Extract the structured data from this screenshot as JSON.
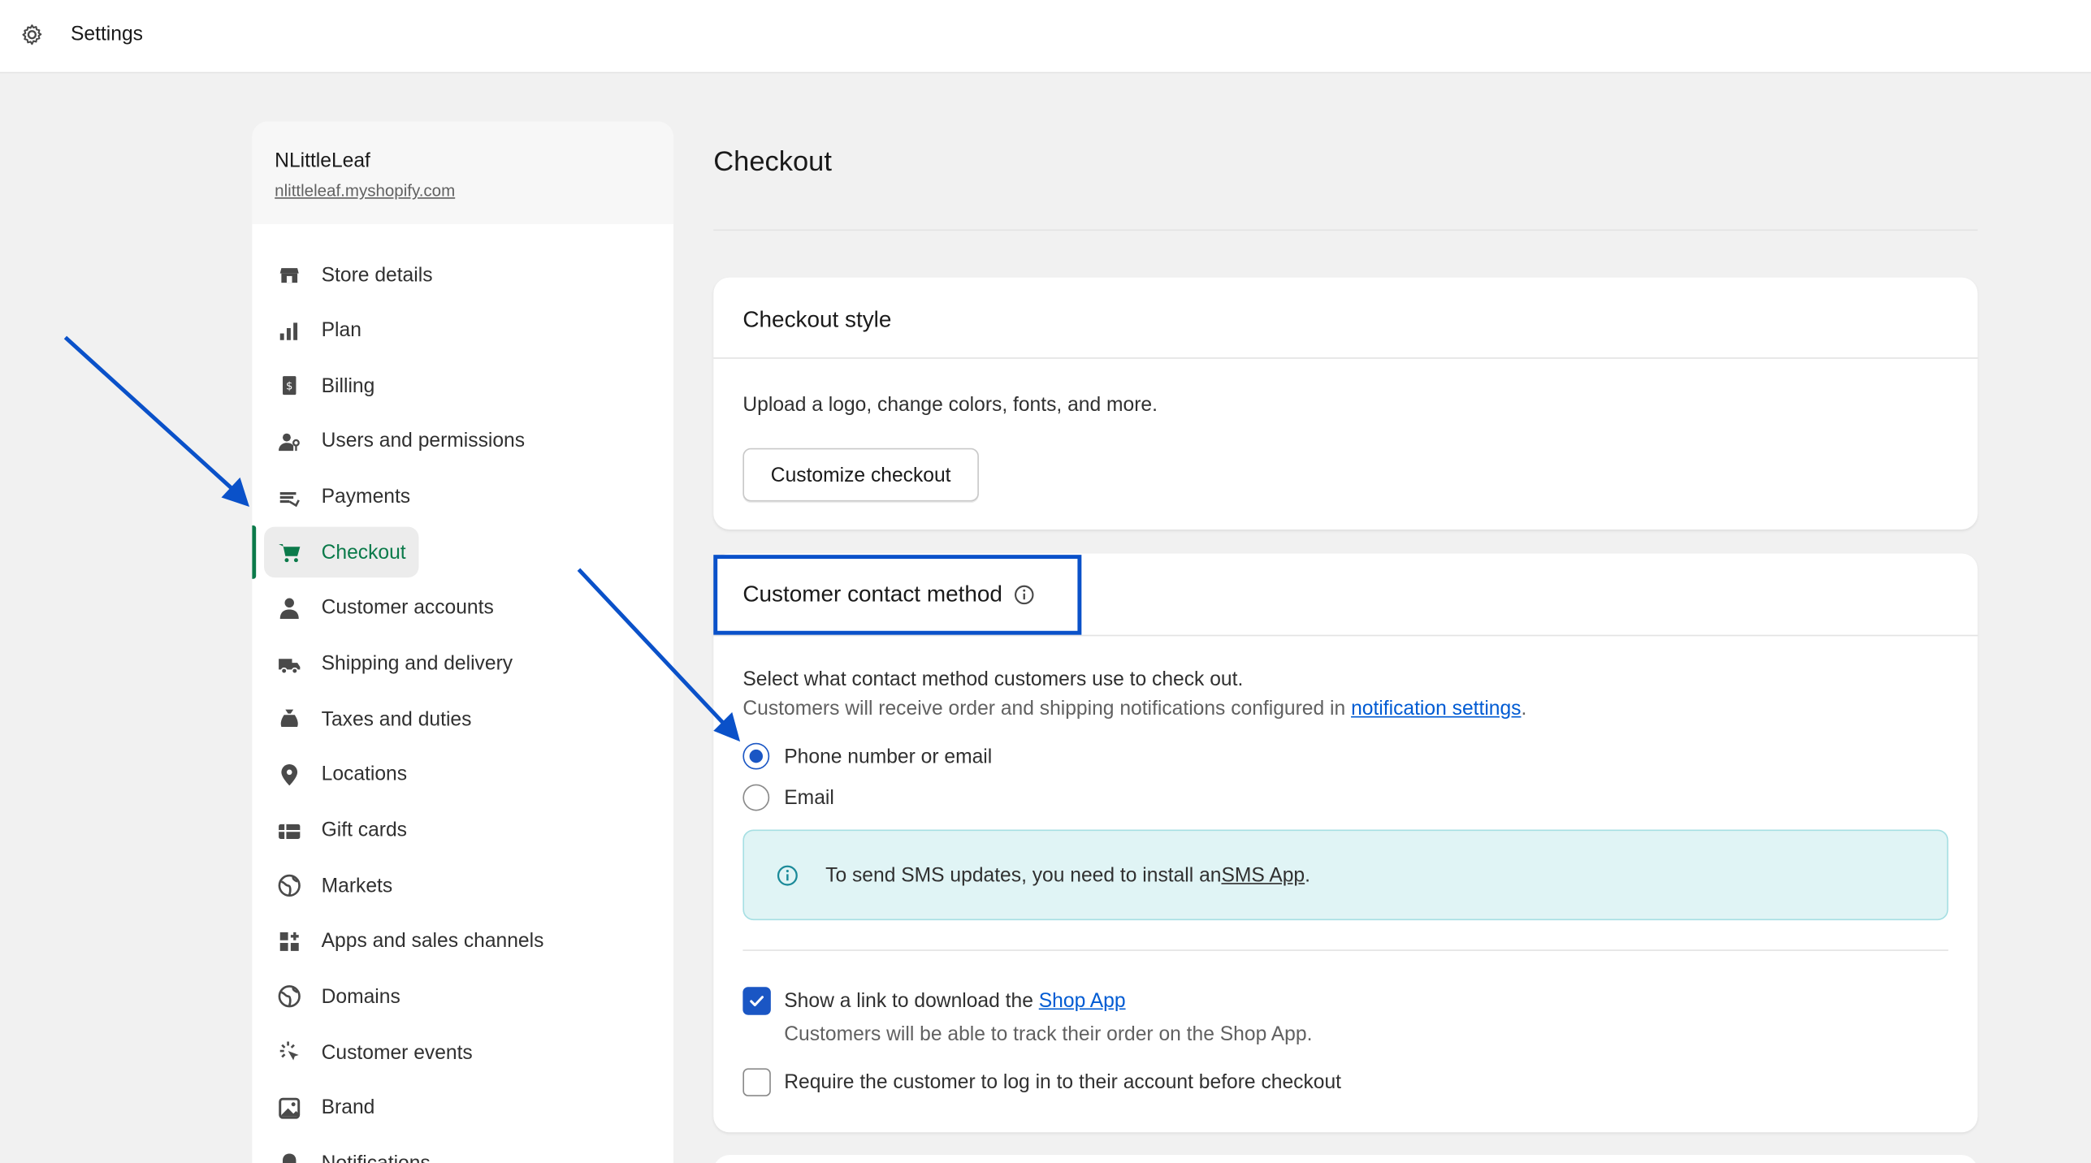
{
  "topbar": {
    "title": "Settings",
    "icon": "gear-icon"
  },
  "store": {
    "name": "NLittleLeaf",
    "url": "nlittleleaf.myshopify.com"
  },
  "sidebar": {
    "items": [
      {
        "label": "Store details",
        "icon": "store-icon"
      },
      {
        "label": "Plan",
        "icon": "plan-icon"
      },
      {
        "label": "Billing",
        "icon": "billing-icon"
      },
      {
        "label": "Users and permissions",
        "icon": "users-icon"
      },
      {
        "label": "Payments",
        "icon": "payments-icon"
      },
      {
        "label": "Checkout",
        "icon": "cart-icon",
        "active": true
      },
      {
        "label": "Customer accounts",
        "icon": "person-icon"
      },
      {
        "label": "Shipping and delivery",
        "icon": "truck-icon"
      },
      {
        "label": "Taxes and duties",
        "icon": "tax-bag-icon"
      },
      {
        "label": "Locations",
        "icon": "location-pin-icon"
      },
      {
        "label": "Gift cards",
        "icon": "gift-card-icon"
      },
      {
        "label": "Markets",
        "icon": "globe-icon"
      },
      {
        "label": "Apps and sales channels",
        "icon": "apps-icon"
      },
      {
        "label": "Domains",
        "icon": "globe-icon"
      },
      {
        "label": "Customer events",
        "icon": "cursor-click-icon"
      },
      {
        "label": "Brand",
        "icon": "image-icon"
      },
      {
        "label": "Notifications",
        "icon": "bell-icon"
      }
    ]
  },
  "main": {
    "title": "Checkout",
    "checkout_style": {
      "title": "Checkout style",
      "description": "Upload a logo, change colors, fonts, and more.",
      "button": "Customize checkout"
    },
    "contact_method": {
      "title": "Customer contact method",
      "line1": "Select what contact method customers use to check out.",
      "line2_prefix": "Customers will receive order and shipping notifications configured in ",
      "line2_link": "notification settings",
      "line2_suffix": ".",
      "options": [
        {
          "label": "Phone number or email",
          "selected": true
        },
        {
          "label": "Email",
          "selected": false
        }
      ],
      "banner_prefix": "To send SMS updates, you need to install an ",
      "banner_link": "SMS App",
      "banner_suffix": ".",
      "shop_app_prefix": "Show a link to download the ",
      "shop_app_link": "Shop App",
      "shop_app_checked": true,
      "shop_app_sub": "Customers will be able to track their order on the Shop App.",
      "require_login": "Require the customer to log in to their account before checkout",
      "require_login_checked": false
    }
  },
  "colors": {
    "accent": "#005bd3",
    "active_nav": "#0b7a4a",
    "annotation": "#0a51c9",
    "banner_bg": "#e0f4f5"
  }
}
